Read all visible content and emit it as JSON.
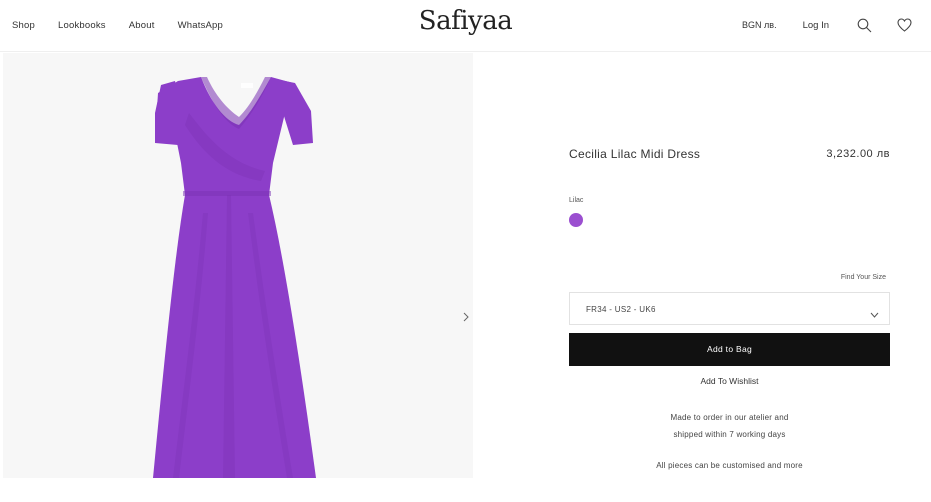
{
  "header": {
    "nav": [
      "Shop",
      "Lookbooks",
      "About",
      "WhatsApp"
    ],
    "logo": "Safiyaa",
    "currency": "BGN лв.",
    "login": "Log In",
    "search_icon": "search-icon",
    "wishlist_icon": "heart-icon"
  },
  "gallery": {
    "image": "lilac-midi-dress-image",
    "next_icon": "chevron-right-icon"
  },
  "product": {
    "title": "Cecilia Lilac Midi Dress",
    "price": "3,232.00 лв",
    "color_label": "Lilac",
    "color_hex": "#9b4fd0",
    "find_size": "Find Your Size",
    "size_selected": "FR34 - US2 - UK6",
    "add_to_bag": "Add to Bag",
    "add_to_wishlist": "Add To Wishlist",
    "made_line1": "Made to order in our atelier and",
    "made_line2": "shipped within 7 working days",
    "customise": "All pieces can be customised and more"
  },
  "colors": {
    "dress": "#8c3ec9",
    "dress_shadow": "#7a32b3",
    "button": "#111111"
  }
}
